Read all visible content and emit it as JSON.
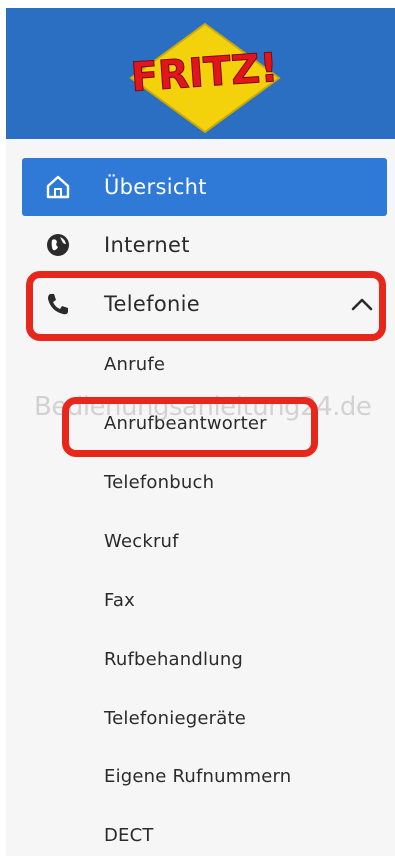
{
  "brand": {
    "logo_text": "FRITZ!",
    "colors": {
      "header": "#2a6fc2",
      "active": "#2f7ad6",
      "highlight": "#e8271c",
      "logo_yellow": "#f4d20b",
      "logo_red": "#e3151c"
    }
  },
  "nav": {
    "items": [
      {
        "label": "Übersicht",
        "icon": "home-icon",
        "active": true
      },
      {
        "label": "Internet",
        "icon": "globe-icon",
        "active": false
      },
      {
        "label": "Telefonie",
        "icon": "phone-icon",
        "active": false,
        "expanded": true,
        "expand_icon": "chevron-up-icon"
      }
    ],
    "telefonie_sub": [
      "Anrufe",
      "Anrufbeantworter",
      "Telefonbuch",
      "Weckruf",
      "Fax",
      "Rufbehandlung",
      "Telefoniegeräte",
      "Eigene Rufnummern",
      "DECT"
    ]
  },
  "watermark": "Bedienungsanleitung24.de"
}
